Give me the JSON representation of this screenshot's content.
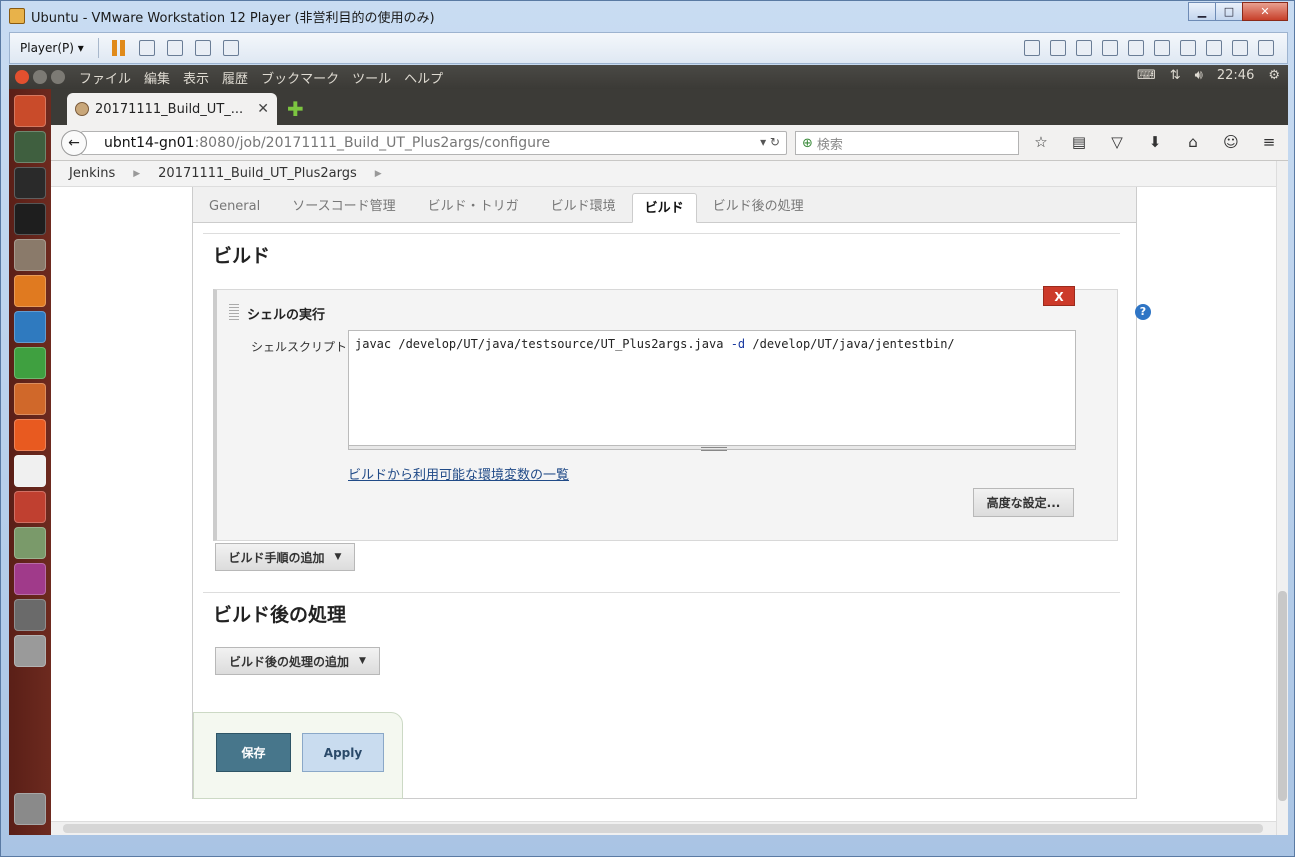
{
  "vm": {
    "title": "Ubuntu - VMware Workstation 12 Player (非営利目的の使用のみ)",
    "player_menu": "Player(P) ▾"
  },
  "ubuntu_panel": {
    "menu": [
      "ファイル",
      "編集",
      "表示",
      "履歴",
      "ブックマーク",
      "ツール",
      "ヘルプ"
    ],
    "time": "22:46"
  },
  "browser": {
    "tab_title": "20171111_Build_UT_...",
    "url_host": "ubnt14-gn01",
    "url_rest": ":8080/job/20171111_Build_UT_Plus2args/configure",
    "search_placeholder": "検索"
  },
  "breadcrumbs": [
    "Jenkins",
    "20171111_Build_UT_Plus2args"
  ],
  "config_tabs": [
    {
      "label": "General",
      "active": false
    },
    {
      "label": "ソースコード管理",
      "active": false
    },
    {
      "label": "ビルド・トリガ",
      "active": false
    },
    {
      "label": "ビルド環境",
      "active": false
    },
    {
      "label": "ビルド",
      "active": true
    },
    {
      "label": "ビルド後の処理",
      "active": false
    }
  ],
  "build_section": {
    "title": "ビルド",
    "step_title": "シェルの実行",
    "delete_label": "X",
    "help_label": "?",
    "field_label": "シェルスクリプト",
    "script_cmd": "javac /develop/UT/java/testsource/UT_Plus2args.java ",
    "script_opt": "-d",
    "script_tail": " /develop/UT/java/jentestbin/",
    "env_link": "ビルドから利用可能な環境変数の一覧",
    "advanced_button": "高度な設定...",
    "add_step_button": "ビルド手順の追加"
  },
  "post_build_section": {
    "title": "ビルド後の処理",
    "add_button": "ビルド後の処理の追加"
  },
  "actions": {
    "save": "保存",
    "apply": "Apply"
  }
}
